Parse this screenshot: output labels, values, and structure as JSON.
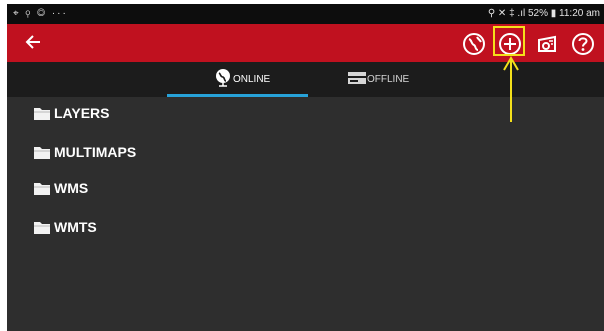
{
  "status_bar": {
    "left_icons": "⌖ ⚲ ◎ ···",
    "right_text": "⚲ ✕ ‡ .ıl 52% ▮ 11:20 am"
  },
  "app_bar": {
    "background": "#c0111f",
    "back_icon": "arrow-left-icon",
    "actions": [
      "globe-icon",
      "add-circle-icon",
      "map-camera-icon",
      "help-icon"
    ]
  },
  "tabs": [
    {
      "label": "ONLINE",
      "icon": "globe-icon",
      "selected": true
    },
    {
      "label": "OFFLINE",
      "icon": "drive-icon",
      "selected": false
    }
  ],
  "folders": [
    {
      "label": "LAYERS"
    },
    {
      "label": "MULTIMAPS"
    },
    {
      "label": "WMS"
    },
    {
      "label": "WMTS"
    }
  ],
  "annotation": {
    "color": "#f4e01b",
    "target": "add-circle-icon"
  }
}
